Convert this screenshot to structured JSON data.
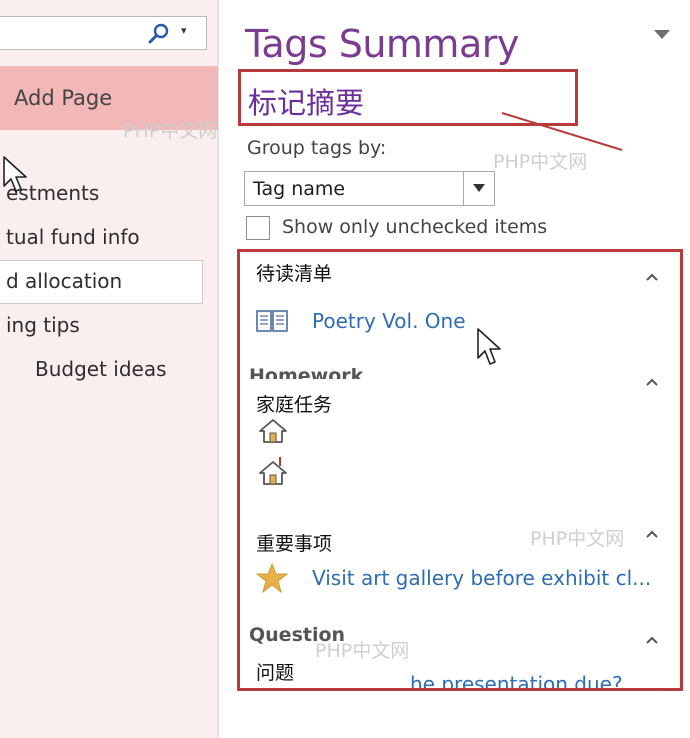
{
  "left_pane": {
    "add_page_label": "Add Page",
    "pages": [
      "estments",
      "tual fund info",
      "d allocation",
      "ing tips",
      "Budget ideas"
    ]
  },
  "tags_pane": {
    "title": "Tags Summary",
    "title_cn": "标记摘要",
    "group_label": "Group tags by:",
    "group_by_value": "Tag name",
    "unchecked_label": "Show only unchecked items",
    "groups": {
      "reading": {
        "cn": "待读清单",
        "items": [
          "Poetry Vol. One"
        ]
      },
      "homework": {
        "en": "Homework",
        "cn": "家庭任务"
      },
      "important": {
        "cn": "重要事项",
        "items": [
          "Visit art gallery before exhibit cl..."
        ]
      },
      "question": {
        "en": "Question",
        "cn": "问题",
        "items": [
          "he presentation due?"
        ]
      }
    }
  },
  "watermarks": [
    "PHP中文网",
    "PHP中文网",
    "PHP中文网",
    "PHP中文网"
  ],
  "colors": {
    "accent_red": "#b83a3a",
    "title_purple": "#7b3c90",
    "link_blue": "#2e6db4",
    "sidebar_selected": "#f2b7b7",
    "star_gold": "#e8b04b"
  },
  "icons": [
    "search-icon",
    "book-icon",
    "house-icon",
    "house-flag-icon",
    "star-icon",
    "mouse-pointer-icon"
  ]
}
